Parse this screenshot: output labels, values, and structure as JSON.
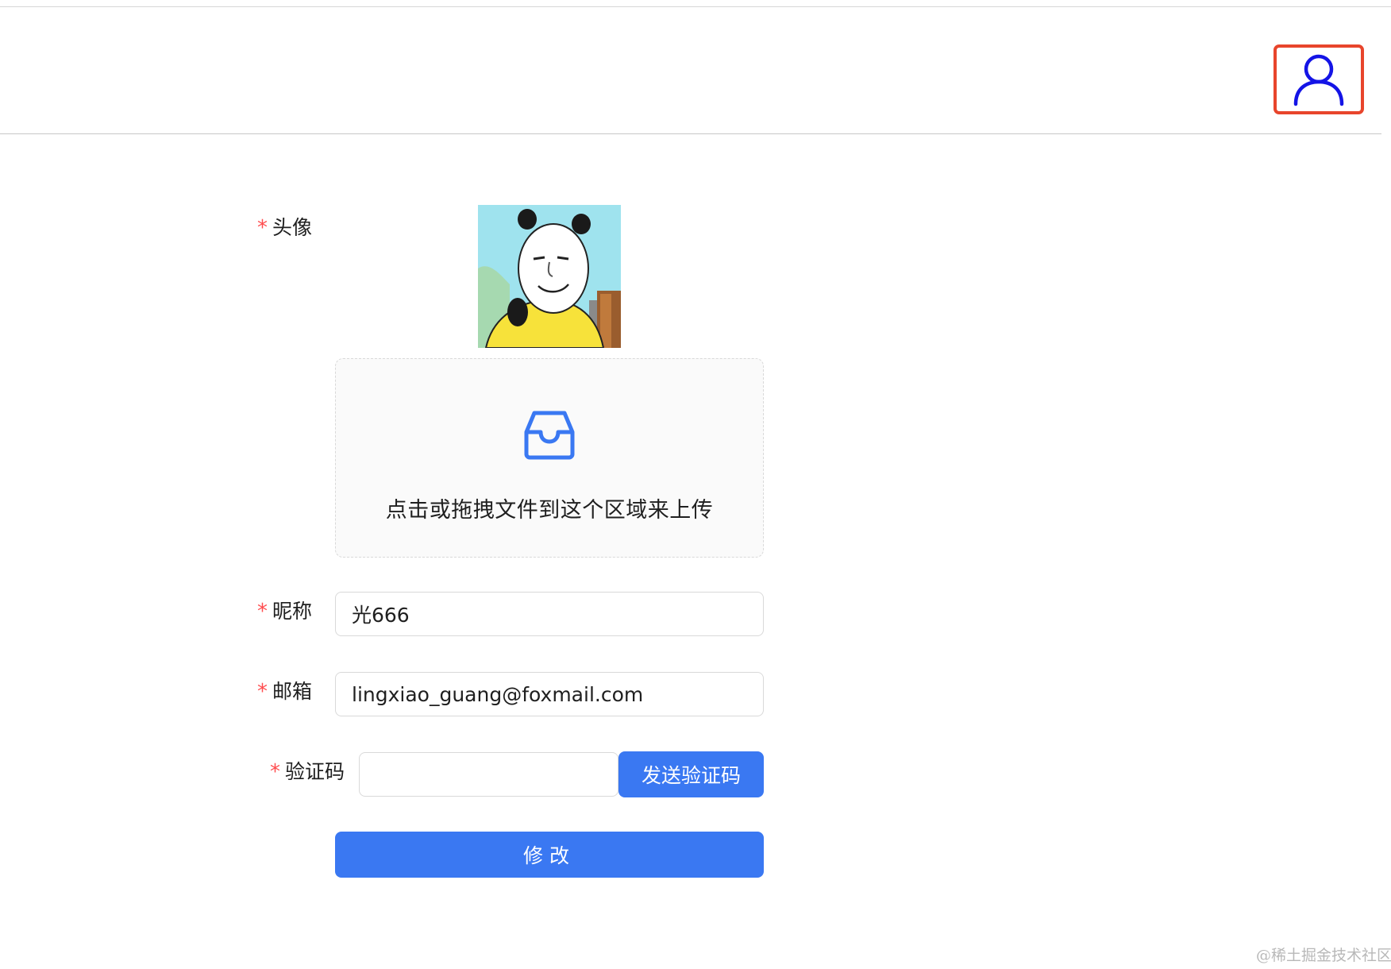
{
  "header": {
    "user_icon": "user-outline-icon"
  },
  "form": {
    "avatar": {
      "label": "头像",
      "upload_text": "点击或拖拽文件到这个区域来上传",
      "upload_icon": "inbox-icon"
    },
    "nickname": {
      "label": "昵称",
      "value": "光666"
    },
    "email": {
      "label": "邮箱",
      "value": "lingxiao_guang@foxmail.com"
    },
    "captcha": {
      "label": "验证码",
      "value": "",
      "send_label": "发送验证码"
    },
    "required_mark": "*",
    "submit_label": "修改"
  },
  "watermark": "@稀土掘金技术社区",
  "colors": {
    "primary": "#3a78f2",
    "required": "#ff4d4f",
    "highlight_border": "#e8452c",
    "user_icon": "#1414e6"
  }
}
